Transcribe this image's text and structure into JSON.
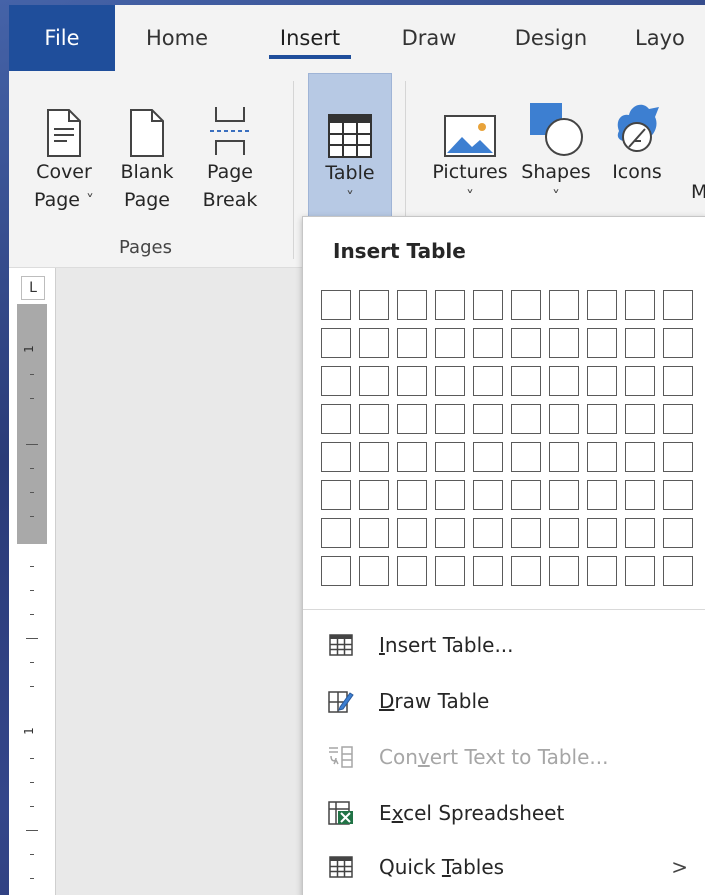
{
  "tabs": [
    {
      "label": "File"
    },
    {
      "label": "Home"
    },
    {
      "label": "Insert"
    },
    {
      "label": "Draw"
    },
    {
      "label": "Design"
    },
    {
      "label": "Layo"
    }
  ],
  "ribbon": {
    "cover_page": {
      "line1": "Cover",
      "line2": "Page",
      "chevron": "˅"
    },
    "blank_page": {
      "line1": "Blank",
      "line2": "Page"
    },
    "page_break": {
      "line1": "Page",
      "line2": "Break"
    },
    "pages_group": "Pages",
    "table": {
      "label": "Table",
      "chevron": "˅"
    },
    "pictures": {
      "label": "Pictures",
      "chevron": "˅"
    },
    "shapes": {
      "label": "Shapes",
      "chevron": "˅"
    },
    "icons": {
      "label": "Icons"
    },
    "clipped_letter": "M"
  },
  "ruler": {
    "tab_selector": "L",
    "numbers": [
      "1",
      "1"
    ]
  },
  "insert_table_menu": {
    "title": "Insert Table",
    "grid_cols": 10,
    "grid_rows": 8,
    "items": [
      {
        "pre": "",
        "accel": "I",
        "post": "nsert Table...",
        "icon": "table-grid-icon",
        "enabled": true
      },
      {
        "pre": "",
        "accel": "D",
        "post": "raw Table",
        "icon": "draw-table-icon",
        "enabled": true
      },
      {
        "pre": "Con",
        "accel": "v",
        "post": "ert Text to Table...",
        "icon": "convert-text-icon",
        "enabled": false
      },
      {
        "pre": "E",
        "accel": "x",
        "post": "cel Spreadsheet",
        "icon": "excel-icon",
        "enabled": true
      },
      {
        "pre": "Quick ",
        "accel": "T",
        "post": "ables",
        "icon": "quick-tables-icon",
        "enabled": true,
        "submenu_arrow": ">"
      }
    ]
  },
  "colors": {
    "accent": "#1f4e9b",
    "pressed": "#b7c9e4",
    "excel_green": "#217346"
  }
}
